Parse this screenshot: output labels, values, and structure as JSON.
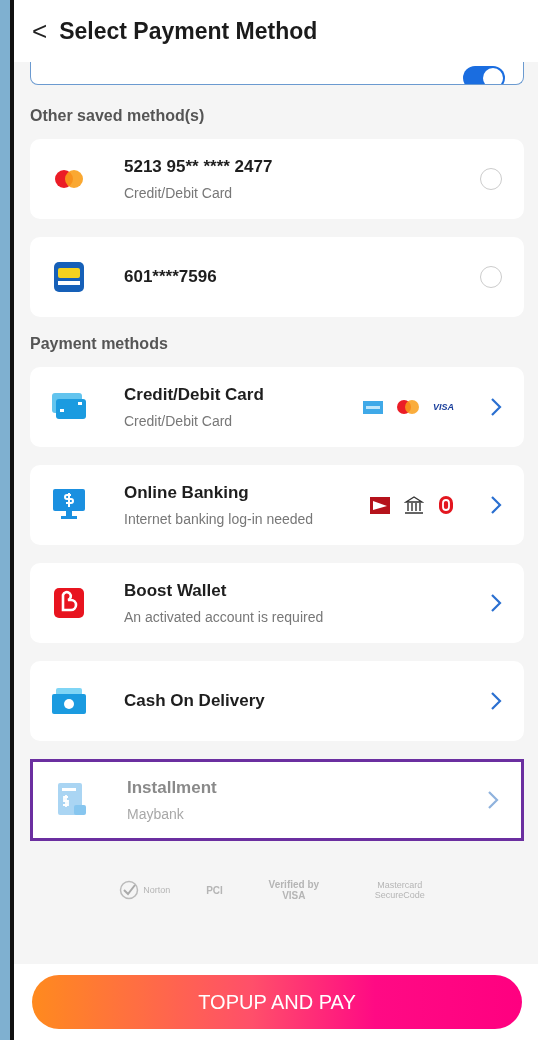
{
  "header": {
    "back": "<",
    "title": "Select Payment Method"
  },
  "fast_topup": {
    "on": true
  },
  "saved_section": {
    "title": "Other saved method(s)",
    "items": [
      {
        "kind": "mastercard",
        "title": "5213 95** **** 2477",
        "subtitle": "Credit/Debit Card",
        "selected": false
      },
      {
        "kind": "tng",
        "title": "601****7596",
        "selected": false
      }
    ]
  },
  "methods_section": {
    "title": "Payment methods",
    "items": [
      {
        "kind": "card",
        "title": "Credit/Debit Card",
        "subtitle": "Credit/Debit Card",
        "logos": [
          {
            "kind": "amex"
          },
          {
            "kind": "mastercard"
          },
          {
            "kind": "visa",
            "text": "VISA"
          }
        ],
        "disabled": false,
        "highlighted": false
      },
      {
        "kind": "bank",
        "title": "Online Banking",
        "subtitle": "Internet banking log-in needed",
        "logos": [
          {
            "kind": "maybank"
          },
          {
            "kind": "bank"
          },
          {
            "kind": "hongleong"
          }
        ],
        "disabled": false,
        "highlighted": false
      },
      {
        "kind": "boost",
        "title": "Boost Wallet",
        "subtitle": "An activated account is required",
        "disabled": false,
        "highlighted": false
      },
      {
        "kind": "cash",
        "title": "Cash On Delivery",
        "disabled": false,
        "highlighted": false
      },
      {
        "kind": "installment",
        "title": "Installment",
        "subtitle": "Maybank",
        "disabled": true,
        "highlighted": true
      }
    ]
  },
  "trust_badges": [
    {
      "kind": "check",
      "text": "Norton"
    },
    {
      "kind": "pci",
      "text": "PCI"
    },
    {
      "kind": "visa",
      "text": "Verified by VISA"
    },
    {
      "kind": "plain",
      "text": "Mastercard SecureCode"
    }
  ],
  "pay_button": "TOPUP AND PAY"
}
